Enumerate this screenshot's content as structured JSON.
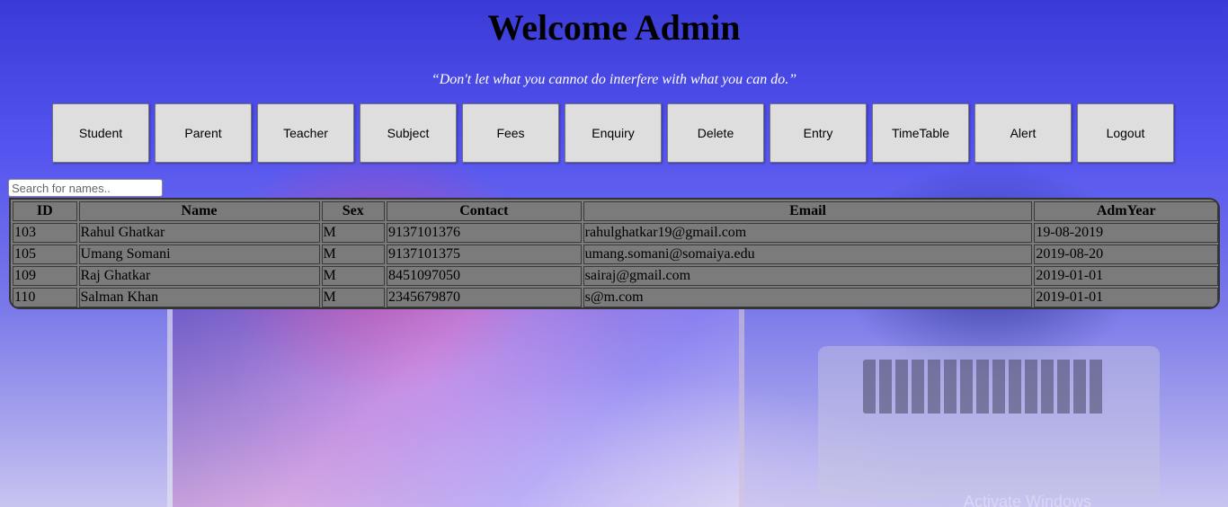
{
  "header": {
    "title": "Welcome Admin",
    "quote": "“Don't let what you cannot do interfere with what you can do.”"
  },
  "nav": {
    "buttons": [
      {
        "label": "Student"
      },
      {
        "label": "Parent"
      },
      {
        "label": "Teacher"
      },
      {
        "label": "Subject"
      },
      {
        "label": "Fees"
      },
      {
        "label": "Enquiry"
      },
      {
        "label": "Delete"
      },
      {
        "label": "Entry"
      },
      {
        "label": "TimeTable"
      },
      {
        "label": "Alert"
      },
      {
        "label": "Logout"
      }
    ]
  },
  "search": {
    "placeholder": "Search for names..",
    "value": ""
  },
  "table": {
    "columns": [
      "ID",
      "Name",
      "Sex",
      "Contact",
      "Email",
      "AdmYear"
    ],
    "rows": [
      [
        "103",
        "Rahul Ghatkar",
        "M",
        "9137101376",
        "rahulghatkar19@gmail.com",
        "19-08-2019"
      ],
      [
        "105",
        "Umang Somani",
        "M",
        "9137101375",
        "umang.somani@somaiya.edu",
        "2019-08-20"
      ],
      [
        "109",
        "Raj Ghatkar",
        "M",
        "8451097050",
        "sairaj@gmail.com",
        "2019-01-01"
      ],
      [
        "110",
        "Salman Khan",
        "M",
        "2345679870",
        "s@m.com",
        "2019-01-01"
      ]
    ]
  },
  "watermark": "Activate Windows"
}
